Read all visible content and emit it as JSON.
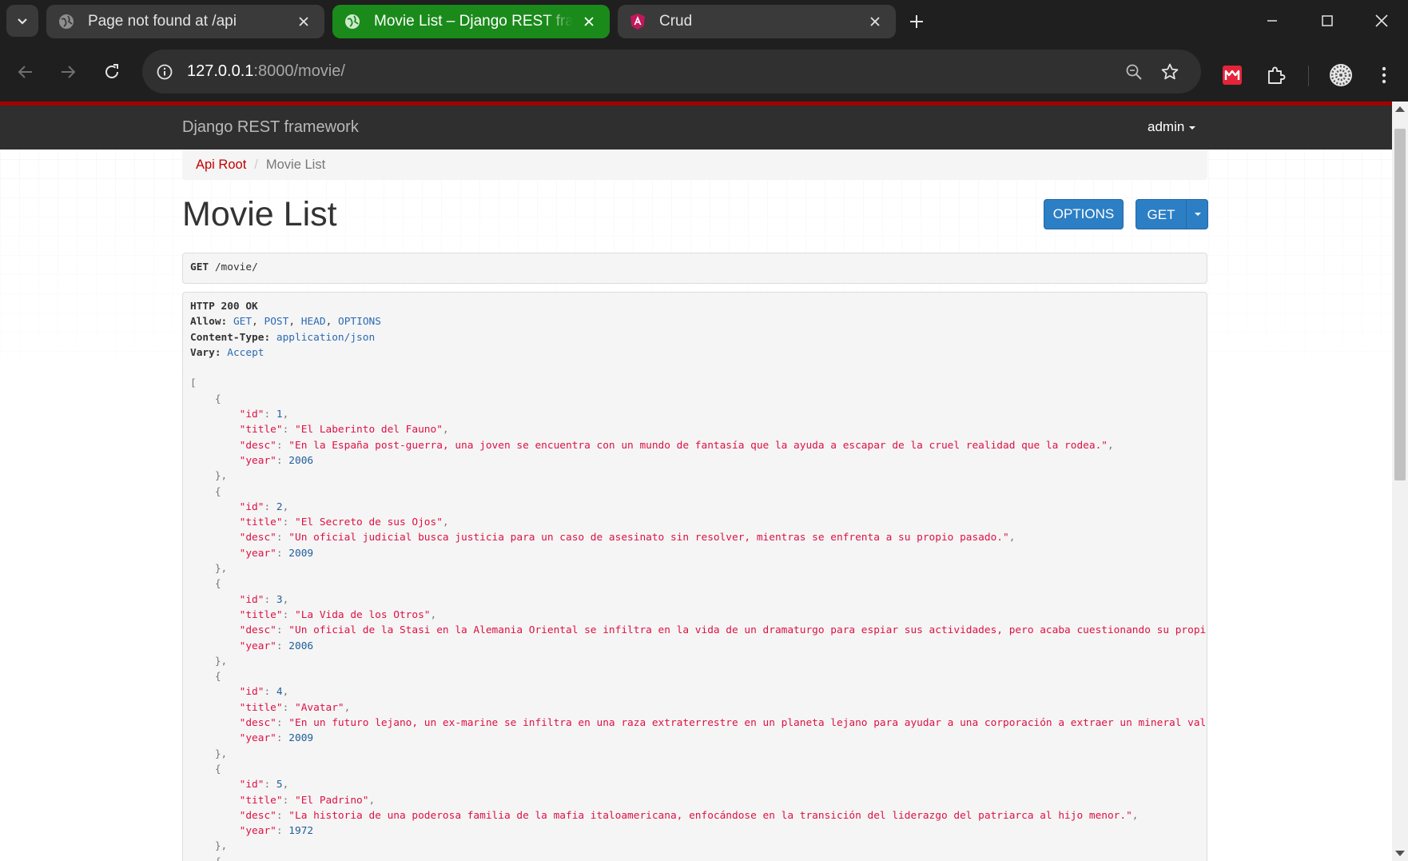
{
  "browser": {
    "tabs": [
      {
        "title": "Page not found at /api",
        "active": false,
        "icon": "globe-icon"
      },
      {
        "title": "Movie List – Django REST framework",
        "active": true,
        "icon": "globe-icon"
      },
      {
        "title": "Crud",
        "active": false,
        "icon": "angular-icon"
      }
    ],
    "url_host": "127.0.0.1",
    "url_rest": ":8000/movie/"
  },
  "app": {
    "brand": "Django REST framework",
    "user": "admin"
  },
  "breadcrumb": {
    "root": "Api Root",
    "current": "Movie List"
  },
  "page": {
    "title": "Movie List",
    "options_label": "OPTIONS",
    "get_label": "GET"
  },
  "request": {
    "method": "GET",
    "path": "/movie/"
  },
  "response": {
    "status": "HTTP 200 OK",
    "headers": [
      {
        "name": "Allow",
        "value": "GET, POST, HEAD, OPTIONS"
      },
      {
        "name": "Content-Type",
        "value": "application/json"
      },
      {
        "name": "Vary",
        "value": "Accept"
      }
    ],
    "items": [
      {
        "id": "1",
        "title": "El Laberinto del Fauno",
        "desc": "En la España post-guerra, una joven se encuentra con un mundo de fantasía que la ayuda a escapar de la cruel realidad que la rodea.",
        "year": "2006"
      },
      {
        "id": "2",
        "title": "El Secreto de sus Ojos",
        "desc": "Un oficial judicial busca justicia para un caso de asesinato sin resolver, mientras se enfrenta a su propio pasado.",
        "year": "2009"
      },
      {
        "id": "3",
        "title": "La Vida de los Otros",
        "desc": "Un oficial de la Stasi en la Alemania Oriental se infiltra en la vida de un dramaturgo para espiar sus actividades, pero acaba cuestionando su propia leal",
        "year": "2006"
      },
      {
        "id": "4",
        "title": "Avatar",
        "desc": "En un futuro lejano, un ex-marine se infiltra en una raza extraterrestre en un planeta lejano para ayudar a una corporación a extraer un mineral valioso.",
        "year": "2009"
      },
      {
        "id": "5",
        "title": "El Padrino",
        "desc": "La historia de una poderosa familia de la mafia italoamericana, enfocándose en la transición del liderazgo del patriarca al hijo menor.",
        "year": "1972"
      }
    ]
  },
  "colors": {
    "tab_active": "#1a8a1a",
    "accent_red": "#a30000",
    "link_red": "#c20000",
    "button_blue": "#2c7fc4",
    "json_string": "#dd1144",
    "json_number": "#1f5d9a"
  }
}
